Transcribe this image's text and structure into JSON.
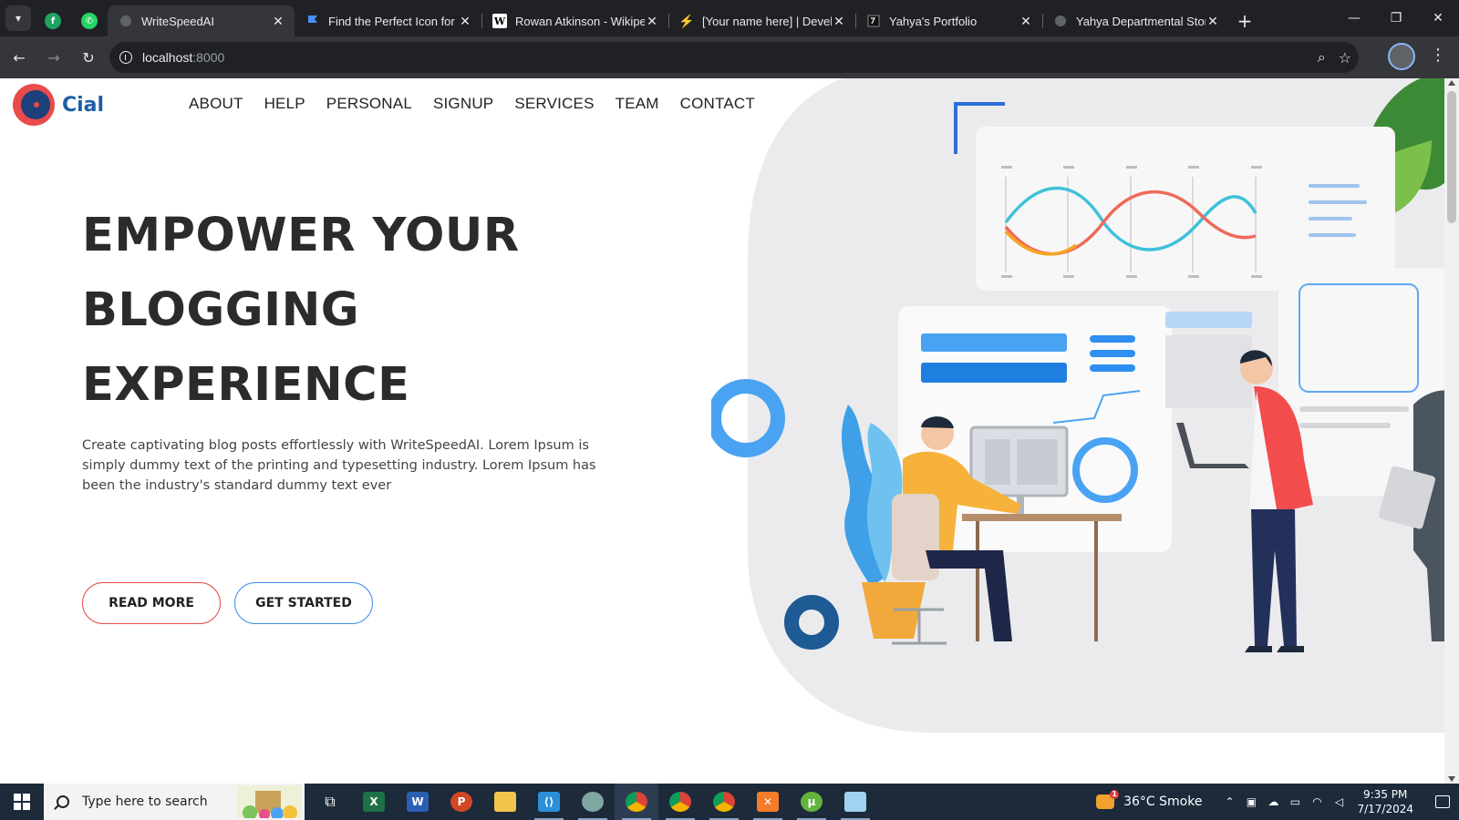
{
  "browser": {
    "tabs": [
      {
        "title": "WriteSpeedAI",
        "active": true,
        "favicon": "globe-icon"
      },
      {
        "title": "Find the Perfect Icon for Your",
        "favicon": "flag-icon",
        "color": "#4a8ff5"
      },
      {
        "title": "Rowan Atkinson - Wikipedia",
        "favicon": "wikipedia-icon"
      },
      {
        "title": "[Your name here] | Developer",
        "favicon": "lightning-icon",
        "color": "#f4b400"
      },
      {
        "title": "Yahya's Portfolio",
        "favicon": "portfolio-icon"
      },
      {
        "title": "Yahya Departmental Store",
        "favicon": "globe-icon"
      }
    ],
    "url_host": "localhost",
    "url_port": ":8000"
  },
  "page": {
    "logo_text": "Cial",
    "nav": [
      "ABOUT",
      "HELP",
      "PERSONAL",
      "SIGNUP",
      "SERVICES",
      "TEAM",
      "CONTACT"
    ],
    "hero": {
      "title_lines": [
        "EMPOWER YOUR",
        "BLOGGING",
        "EXPERIENCE"
      ],
      "description": "Create captivating blog posts effortlessly with WriteSpeedAI. Lorem Ipsum is simply dummy text of the printing and typesetting industry. Lorem Ipsum has been the industry's standard dummy text ever",
      "read_more": "READ MORE",
      "get_started": "GET STARTED"
    },
    "colors": {
      "accent_red": "#e94a4a",
      "accent_blue": "#3d8fe8",
      "logo_blue": "#1d5fa7"
    }
  },
  "taskbar": {
    "search_placeholder": "Type here to search",
    "apps": [
      {
        "name": "task-view-icon",
        "label": "",
        "color": "transparent"
      },
      {
        "name": "excel-icon",
        "label": "X",
        "color": "#1e7145"
      },
      {
        "name": "word-icon",
        "label": "W",
        "color": "#2b5fb4"
      },
      {
        "name": "powerpoint-icon",
        "label": "P",
        "color": "#d24726"
      },
      {
        "name": "file-explorer-icon",
        "label": "",
        "color": "#f2c44b"
      },
      {
        "name": "vscode-icon",
        "label": "",
        "color": "#2c8fd8"
      },
      {
        "name": "app-icon",
        "label": "",
        "color": "#7fa6a0"
      },
      {
        "name": "chrome-icon",
        "label": "",
        "color": "#db4437"
      },
      {
        "name": "chrome-profile-icon",
        "label": "",
        "color": "#db4437"
      },
      {
        "name": "chrome-profile-2-icon",
        "label": "",
        "color": "#db4437"
      },
      {
        "name": "xampp-icon",
        "label": "",
        "color": "#f57c2a"
      },
      {
        "name": "utorrent-icon",
        "label": "",
        "color": "#64b33c"
      },
      {
        "name": "notes-icon",
        "label": "",
        "color": "#9fd3f0"
      }
    ],
    "weather": "36°C  Smoke",
    "weather_badge": "1",
    "time": "9:35 PM",
    "date": "7/17/2024"
  }
}
